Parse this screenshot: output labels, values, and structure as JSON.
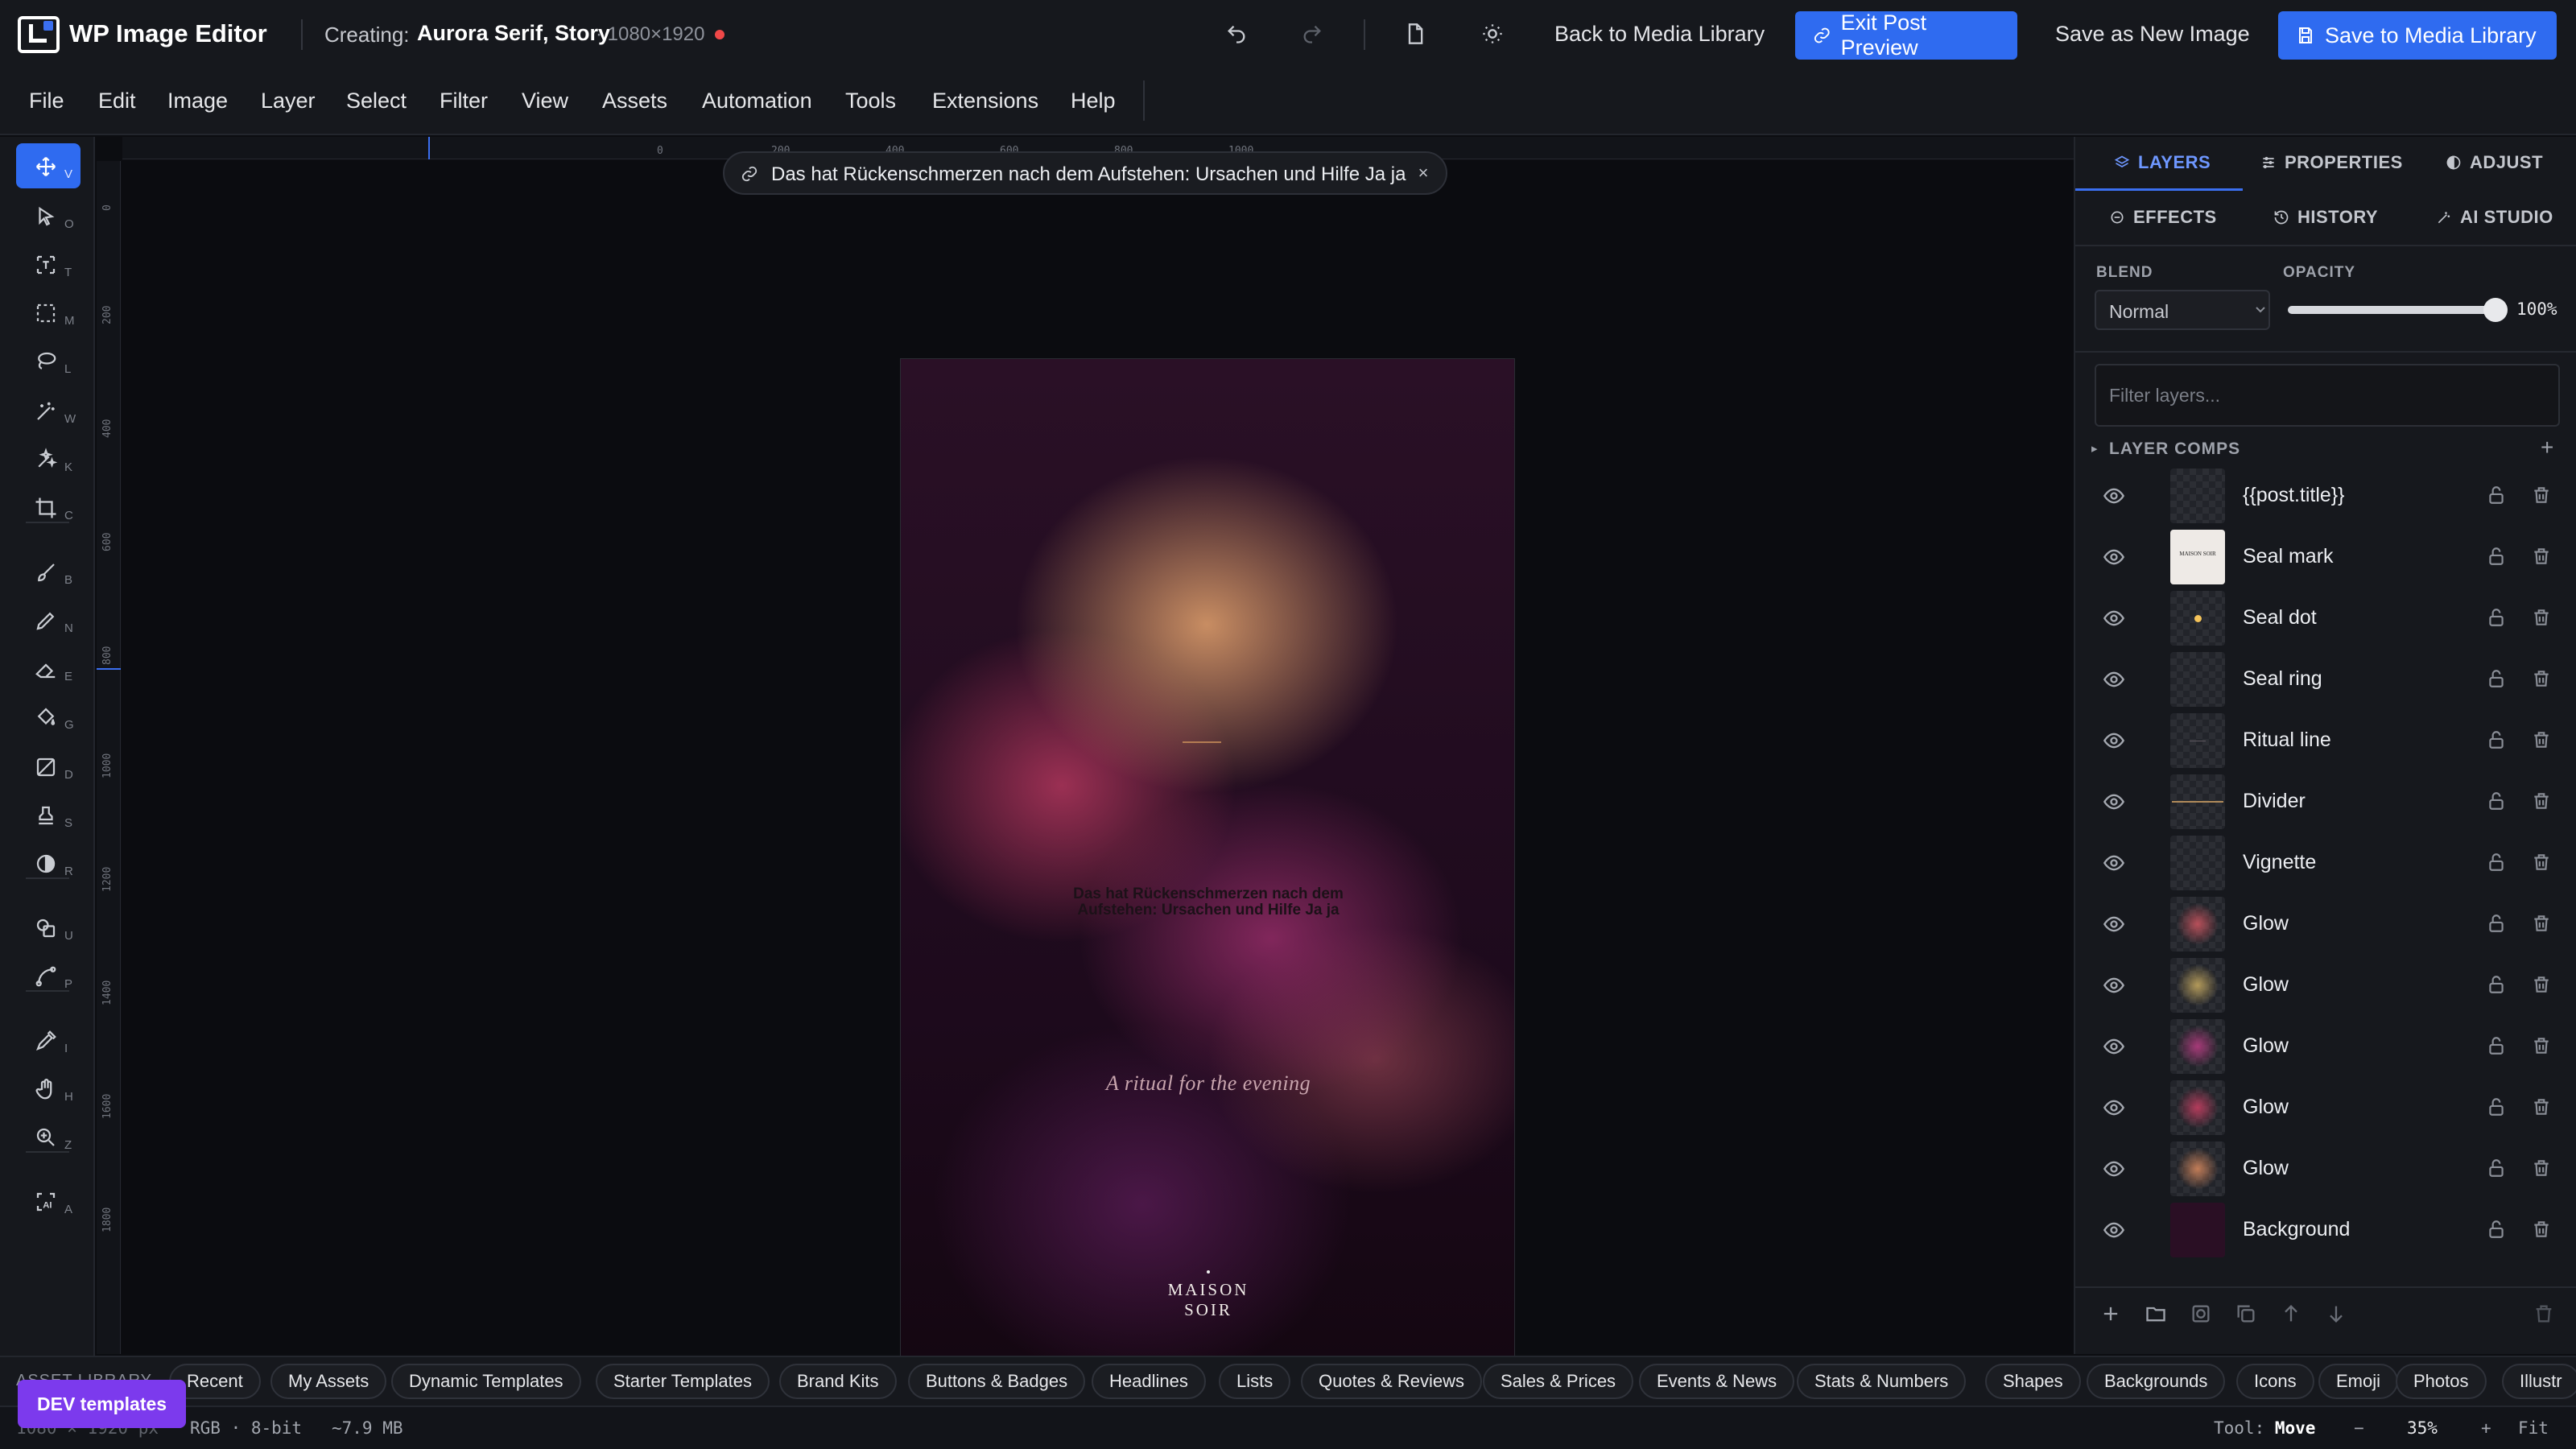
{
  "app": {
    "title": "WP Image Editor",
    "creating_label": "Creating:",
    "document_name": "Aurora Serif, Story",
    "document_size": "· 1080×1920",
    "unsaved": true
  },
  "topbar": {
    "back_label": "Back to Media Library",
    "exit_preview_label": "Exit Post Preview",
    "save_new_label": "Save as New Image",
    "save_media_label": "Save to Media Library",
    "accent": "#2f6bf0"
  },
  "menu": [
    "File",
    "Edit",
    "Image",
    "Layer",
    "Select",
    "Filter",
    "View",
    "Assets",
    "Automation",
    "Tools",
    "Extensions",
    "Help"
  ],
  "tools": [
    {
      "name": "move",
      "key": "V",
      "active": true
    },
    {
      "name": "direct-select",
      "key": "O"
    },
    {
      "name": "type",
      "key": "T"
    },
    {
      "name": "marquee",
      "key": "M"
    },
    {
      "name": "lasso",
      "key": "L"
    },
    {
      "name": "magic-wand",
      "key": "W"
    },
    {
      "name": "quick-select",
      "key": "K"
    },
    {
      "name": "crop",
      "key": "C"
    },
    {
      "name": "brush",
      "key": "B"
    },
    {
      "name": "pencil",
      "key": "N"
    },
    {
      "name": "eraser",
      "key": "E"
    },
    {
      "name": "paint-bucket",
      "key": "G"
    },
    {
      "name": "gradient",
      "key": "D"
    },
    {
      "name": "clone-stamp",
      "key": "S"
    },
    {
      "name": "dodge-burn",
      "key": "R"
    },
    {
      "name": "shapes",
      "key": "U"
    },
    {
      "name": "pen",
      "key": "P"
    },
    {
      "name": "eyedropper",
      "key": "I"
    },
    {
      "name": "hand",
      "key": "H"
    },
    {
      "name": "zoom",
      "key": "Z"
    },
    {
      "name": "ai-select",
      "key": "A"
    }
  ],
  "rulers": {
    "top": [
      "0",
      "200",
      "400",
      "600",
      "800",
      "1000"
    ],
    "left": [
      "0",
      "200",
      "400",
      "600",
      "800",
      "1000",
      "1200",
      "1400",
      "1600",
      "1800"
    ]
  },
  "canvas": {
    "post_chip": "Das hat Rückenschmerzen nach dem Aufstehen: Ursachen und Hilfe Ja ja",
    "title_line1": "Das hat Rückenschmerzen nach dem",
    "title_line2": "Aufstehen: Ursachen und Hilfe Ja ja",
    "subtitle": "A ritual for the evening",
    "seal_line1": "MAISON",
    "seal_line2": "SOIR"
  },
  "panel": {
    "tabs_row1": [
      "LAYERS",
      "PROPERTIES",
      "ADJUST"
    ],
    "tabs_row2": [
      "EFFECTS",
      "HISTORY",
      "AI STUDIO"
    ],
    "active_tab": "LAYERS",
    "blend_label": "BLEND",
    "blend_value": "Normal",
    "opacity_label": "OPACITY",
    "opacity_value": "100%",
    "opacity_fraction": 1.0,
    "filter_placeholder": "Filter layers...",
    "layer_comps_label": "LAYER COMPS",
    "layers": [
      {
        "name": "{{post.title}}",
        "thumb": "empty"
      },
      {
        "name": "Seal mark",
        "thumb": "seal-mark"
      },
      {
        "name": "Seal dot",
        "thumb": "seal-dot"
      },
      {
        "name": "Seal ring",
        "thumb": "empty"
      },
      {
        "name": "Ritual line",
        "thumb": "ritual-line"
      },
      {
        "name": "Divider",
        "thumb": "divider"
      },
      {
        "name": "Vignette",
        "thumb": "empty"
      },
      {
        "name": "Glow",
        "thumb": "glow-red"
      },
      {
        "name": "Glow",
        "thumb": "glow-gold"
      },
      {
        "name": "Glow",
        "thumb": "glow-magenta"
      },
      {
        "name": "Glow",
        "thumb": "glow-rose"
      },
      {
        "name": "Glow",
        "thumb": "glow-orange"
      },
      {
        "name": "Background",
        "thumb": "background"
      }
    ],
    "thumb_seal_text": "MAISON SOIR"
  },
  "asset_library": {
    "title": "ASSET LIBRARY",
    "chips": [
      "Recent",
      "My Assets",
      "Dynamic Templates",
      "Starter Templates",
      "Brand Kits",
      "Buttons & Badges",
      "Headlines",
      "Lists",
      "Quotes & Reviews",
      "Sales & Prices",
      "Events & News",
      "Stats & Numbers",
      "Shapes",
      "Backgrounds",
      "Icons",
      "Emoji",
      "Photos",
      "Illustr"
    ],
    "dev_button": "DEV templates"
  },
  "status": {
    "left_info": "1080 × 1920 px",
    "color_mode": "RGB · 8-bit",
    "file_size": "~7.9 MB",
    "tool_label": "Tool:",
    "tool_name": "Move",
    "zoom_out": "−",
    "zoom": "35%",
    "zoom_in": "+",
    "fit": "Fit"
  }
}
